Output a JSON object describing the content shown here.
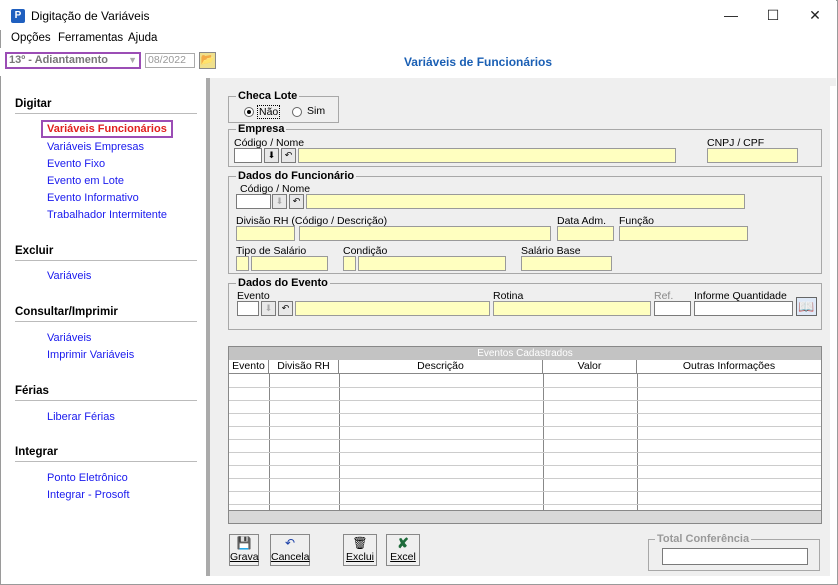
{
  "window": {
    "title": "Digitação de Variáveis",
    "minimize": "—",
    "maximize": "☐",
    "close": "✕"
  },
  "menu": [
    "Opções",
    "Ferramentas",
    "Ajuda"
  ],
  "toolbar": {
    "payroll_type": "13º - Adiantamento",
    "period": "08/2022",
    "page_title": "Variáveis de Funcionários"
  },
  "sidebar": {
    "sections": [
      {
        "title": "Digitar",
        "items": [
          "Variáveis Funcionários",
          "Variáveis Empresas",
          "Evento Fixo",
          "Evento em Lote",
          "Evento Informativo",
          "Trabalhador Intermitente"
        ]
      },
      {
        "title": "Excluir",
        "items": [
          "Variáveis"
        ]
      },
      {
        "title": "Consultar/Imprimir",
        "items": [
          "Variáveis",
          "Imprimir Variáveis"
        ]
      },
      {
        "title": "Férias",
        "items": [
          "Liberar Férias"
        ]
      },
      {
        "title": "Integrar",
        "items": [
          "Ponto Eletrônico",
          "Integrar - Prosoft"
        ]
      }
    ],
    "active_item": "Variáveis Funcionários"
  },
  "checa_lote": {
    "legend": "Checa Lote",
    "options": [
      "Não",
      "Sim"
    ],
    "selected": "Não"
  },
  "empresa": {
    "legend": "Empresa",
    "code_name_label": "Código / Nome",
    "cnpj_label": "CNPJ / CPF"
  },
  "funcionario": {
    "legend": "Dados do Funcionário",
    "code_name_label": "Código / Nome",
    "divisao_label": "Divisão RH (Código / Descrição)",
    "data_adm_label": "Data Adm.",
    "funcao_label": "Função",
    "tipo_salario_label": "Tipo de Salário",
    "condicao_label": "Condição",
    "salario_base_label": "Salário Base"
  },
  "evento": {
    "legend": "Dados do Evento",
    "evento_label": "Evento",
    "rotina_label": "Rotina",
    "ref_label": "Ref.",
    "quantidade_label": "Informe Quantidade"
  },
  "grid": {
    "title": "Eventos Cadastrados",
    "columns": [
      "Evento",
      "Divisão RH",
      "Descrição",
      "Valor",
      "Outras Informações"
    ]
  },
  "buttons": {
    "grava": "Grava",
    "cancela": "Cancela",
    "exclui": "Exclui",
    "excel": "Excel"
  },
  "total": {
    "legend": "Total Conferência"
  }
}
